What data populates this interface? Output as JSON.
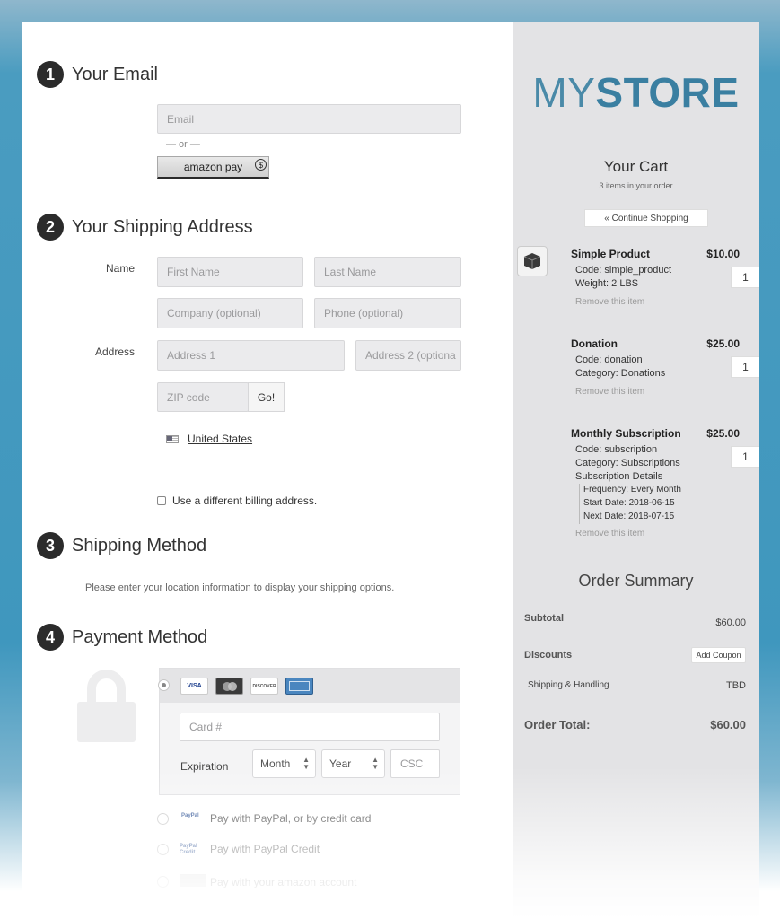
{
  "steps": {
    "email": {
      "num": "1",
      "title": "Your Email"
    },
    "shipping_address": {
      "num": "2",
      "title": "Your Shipping Address"
    },
    "shipping_method": {
      "num": "3",
      "title": "Shipping Method"
    },
    "payment_method": {
      "num": "4",
      "title": "Payment Method"
    }
  },
  "email": {
    "placeholder": "Email",
    "or_text": "— or —",
    "amazon_pay_label": "amazon pay",
    "amazon_pay_coin": "$"
  },
  "address": {
    "name_label": "Name",
    "first_name_placeholder": "First Name",
    "last_name_placeholder": "Last Name",
    "company_placeholder": "Company (optional)",
    "phone_placeholder": "Phone (optional)",
    "address_label": "Address",
    "address1_placeholder": "Address 1",
    "address2_placeholder": "Address 2 (optiona",
    "zip_placeholder": "ZIP code",
    "go_label": "Go!",
    "country_link": "United States",
    "billing_checkbox_label": "Use a different billing address."
  },
  "shipping_method": {
    "message": "Please enter your location information to display your shipping options."
  },
  "payment": {
    "cards": [
      "VISA",
      "",
      "DISCOVER",
      ""
    ],
    "card_placeholder": "Card #",
    "expiration_label": "Expiration",
    "month_value": "Month",
    "year_value": "Year",
    "csc_placeholder": "CSC",
    "paypal_label": "Pay with PayPal, or by credit card",
    "paypal_icon_text": "PayPal",
    "paypal_credit_label": "Pay with PayPal Credit",
    "paypal_credit_icon_text": "PayPal Credit",
    "amazon_account_label": "Pay with your amazon account"
  },
  "store": {
    "logo_my": "MY",
    "logo_store": "STORE"
  },
  "cart": {
    "title": "Your Cart",
    "subtitle": "3 items in your order",
    "continue_label": "« Continue Shopping",
    "remove_label": "Remove this item",
    "items": [
      {
        "name": "Simple Product",
        "price": "$10.00",
        "qty": "1",
        "lines": [
          "Code: simple_product",
          "Weight: 2 LBS"
        ]
      },
      {
        "name": "Donation",
        "price": "$25.00",
        "qty": "1",
        "lines": [
          "Code: donation",
          "Category: Donations"
        ]
      },
      {
        "name": "Monthly Subscription",
        "price": "$25.00",
        "qty": "1",
        "lines": [
          "Code: subscription",
          "Category: Subscriptions",
          "Subscription Details"
        ],
        "details": [
          "Frequency: Every Month",
          "Start Date: 2018-06-15",
          "Next Date: 2018-07-15"
        ]
      }
    ]
  },
  "summary": {
    "title": "Order Summary",
    "subtotal_label": "Subtotal",
    "subtotal_value": "$60.00",
    "discounts_label": "Discounts",
    "add_coupon_label": "Add Coupon",
    "shipping_label": "Shipping & Handling",
    "shipping_value": "TBD",
    "total_label": "Order Total:",
    "total_value": "$60.00"
  },
  "colors": {
    "logo_blue": "#3a7fa1",
    "page_blue": "#3f97be",
    "sidebar_gray": "#e3e3e5"
  }
}
